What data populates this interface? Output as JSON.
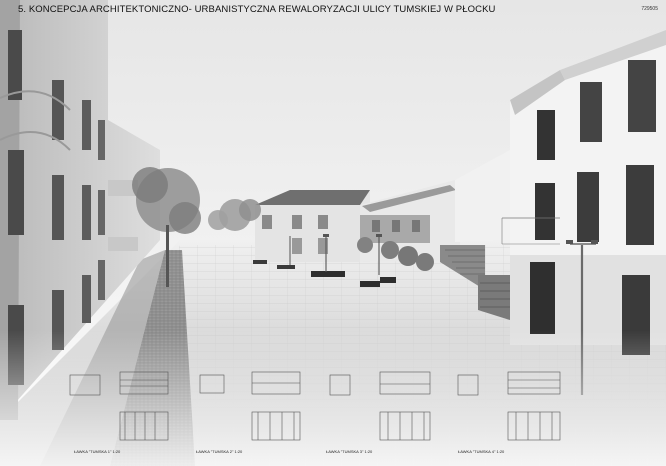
{
  "header": {
    "title": "5. KONCEPCJA ARCHITEKTONICZNO- URBANISTYCZNA REWALORYZACJI ULICY TUMSKIEJ W PŁOCKU",
    "sheet_number": "729505"
  },
  "bench_details": {
    "captions": [
      "ŁAWKA \"TUMSKA 1\" 1:20",
      "ŁAWKA \"TUMSKA 2\" 1:20",
      "ŁAWKA \"TUMSKA 3\" 1:20",
      "ŁAWKA \"TUMSKA 4\" 1:20"
    ]
  },
  "colors": {
    "sky": "#f2f2f2",
    "pavement": "#d8d8d8",
    "facade_left": "#c9c9c9",
    "facade_right": "#efefef",
    "trees": "#8a8a8a",
    "line": "#555555"
  },
  "icons": [
    "street-lamp-icon",
    "bench-icon",
    "tree-icon"
  ]
}
